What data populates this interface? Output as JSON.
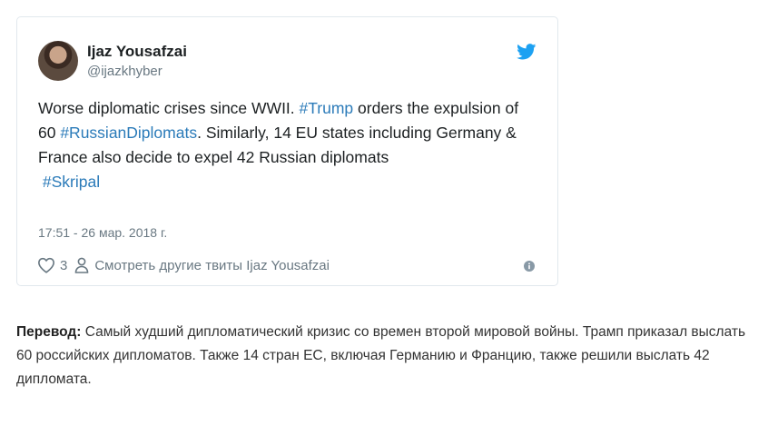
{
  "tweet": {
    "author_name": "Ijaz Yousafzai",
    "author_handle": "@ijazkhyber",
    "text": {
      "p1": "Worse diplomatic crises since WWII. ",
      "h1": "#Trump",
      "p2": " orders the expulsion of 60 ",
      "h2": "#RussianDiplomats",
      "p3": ". Similarly, 14 EU states including Germany & France also decide to expel 42 Russian diplomats",
      "h3": "#Skripal"
    },
    "timestamp": "17:51 - 26 мар. 2018 г.",
    "likes": "3",
    "more_tweets_label": "Смотреть другие твиты Ijaz Yousafzai",
    "icons": {
      "bird": "twitter-bird-icon",
      "heart": "heart-icon",
      "person": "person-icon",
      "info": "info-icon"
    },
    "colors": {
      "link": "#2b7bb9",
      "bird": "#1da1f2",
      "muted": "#697882"
    }
  },
  "translation": {
    "label": "Перевод:",
    "text": " Самый худший дипломатический кризис со времен второй мировой войны. Трамп приказал выслать 60 российских дипломатов. Также 14 стран ЕС, включая Германию и Францию, также решили выслать 42 дипломата."
  }
}
